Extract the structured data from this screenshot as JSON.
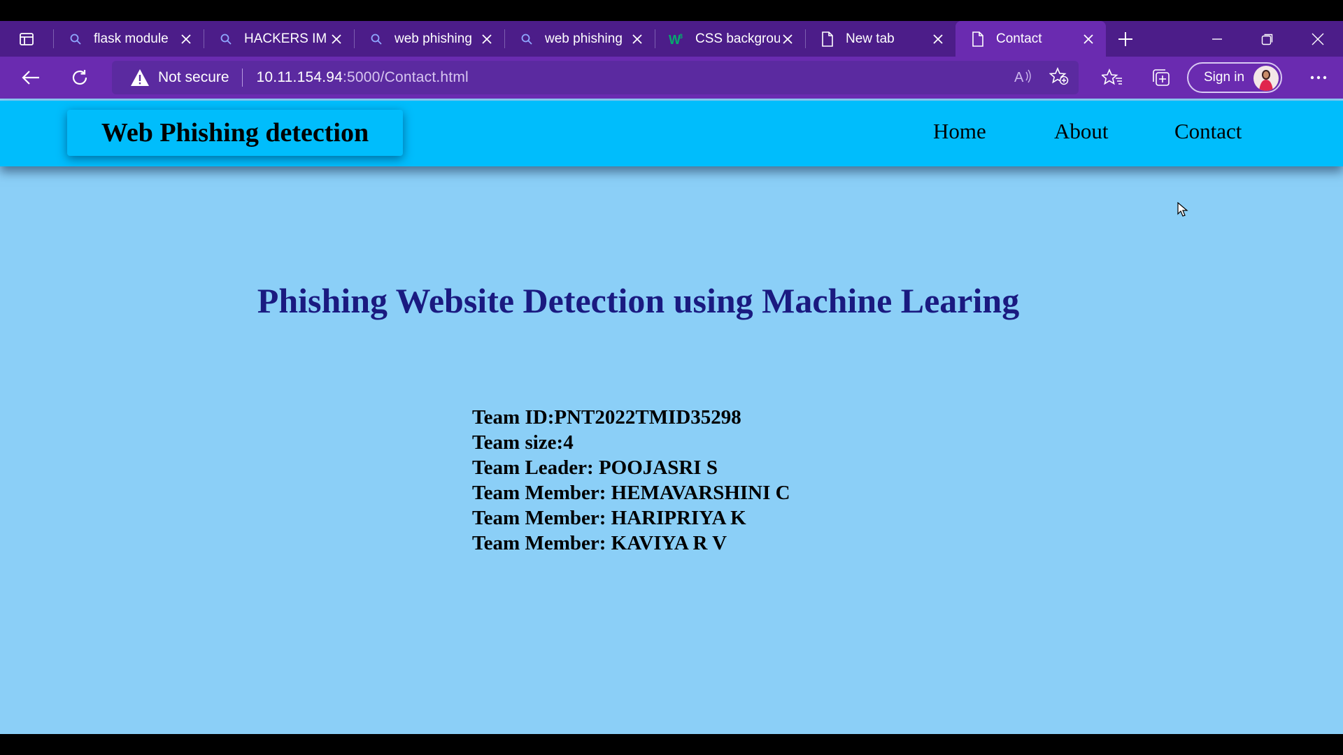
{
  "browser": {
    "tabs": [
      {
        "title": "flask module",
        "icon": "search-icon"
      },
      {
        "title": "HACKERS IM",
        "icon": "search-icon"
      },
      {
        "title": "web phishing",
        "icon": "search-icon"
      },
      {
        "title": "web phishing",
        "icon": "search-icon"
      },
      {
        "title": "CSS backgrou",
        "icon": "w3schools-icon"
      },
      {
        "title": "New tab",
        "icon": "page-icon"
      },
      {
        "title": "Contact",
        "icon": "page-icon",
        "active": true
      }
    ],
    "security_label": "Not secure",
    "url_host": "10.11.154.94",
    "url_path": ":5000/Contact.html",
    "sign_in_label": "Sign in",
    "colors": {
      "tab_strip": "#4c1d89",
      "toolbar": "#6a2bb0"
    }
  },
  "site": {
    "brand": "Web Phishing detection",
    "nav": {
      "home": "Home",
      "about": "About",
      "contact": "Contact"
    },
    "heading": "Phishing Website Detection using Machine Learing",
    "team": [
      "Team ID:PNT2022TMID35298",
      "Team size:4",
      "Team Leader: POOJASRI S",
      "Team Member: HEMAVARSHINI C",
      "Team Member: HARIPRIYA K",
      "Team Member: KAVIYA R V"
    ],
    "colors": {
      "navbar": "#00bdfc",
      "background": "#8bcff7",
      "heading": "#1a1a80"
    }
  }
}
